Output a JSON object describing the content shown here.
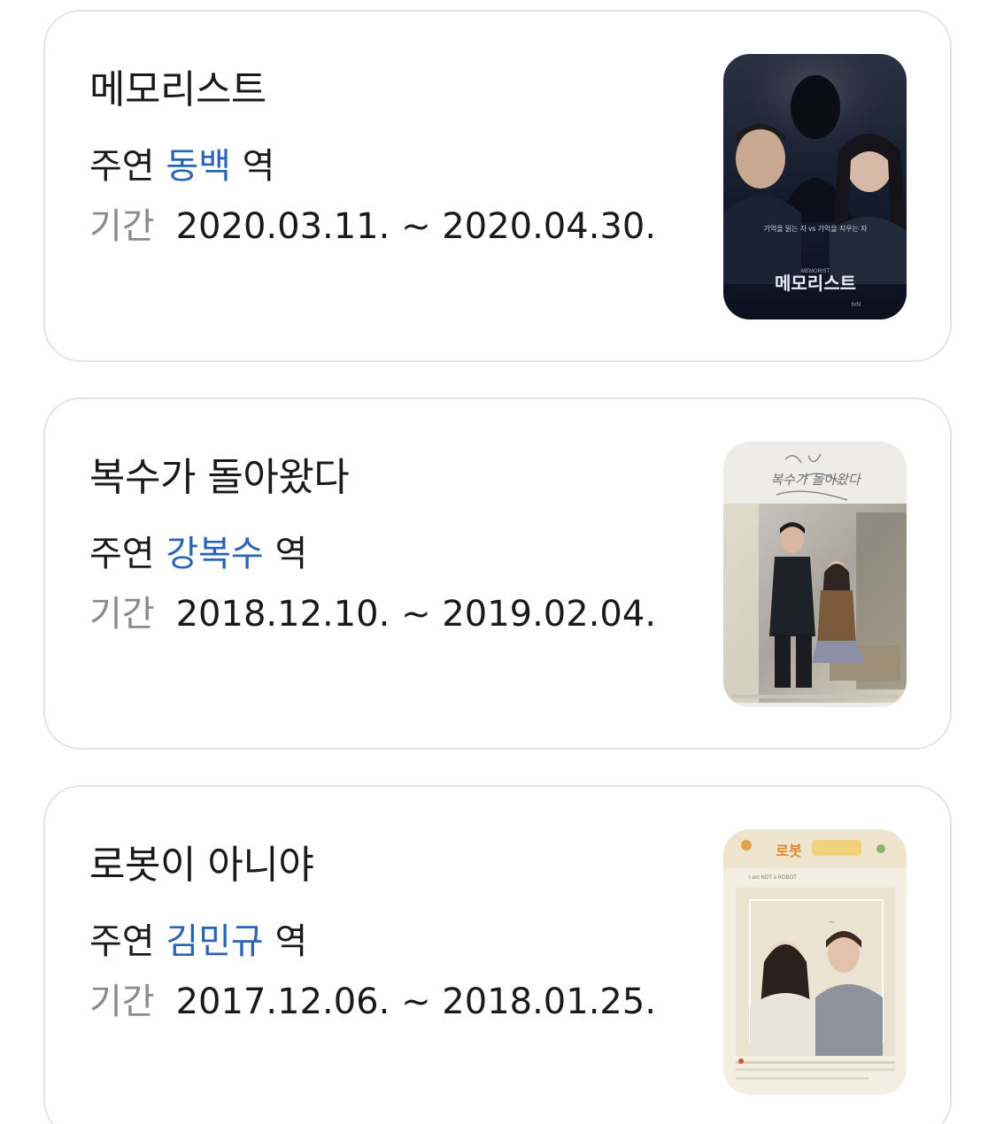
{
  "dramas": [
    {
      "title": "메모리스트",
      "role_prefix": "주연",
      "role_name": "동백",
      "role_suffix": "역",
      "period_label": "기간",
      "period": "2020.03.11. ~ 2020.04.30.",
      "poster": {
        "title_text": "메모리스트",
        "tagline": "기억을 읽는 자 vs 기억을 지우는 자",
        "subtitle": "MEMORIST",
        "network": "tvN"
      }
    },
    {
      "title": "복수가 돌아왔다",
      "role_prefix": "주연",
      "role_name": "강복수",
      "role_suffix": "역",
      "period_label": "기간",
      "period": "2018.12.10. ~ 2019.02.04.",
      "poster": {
        "title_text": "복수가 돌아왔다"
      }
    },
    {
      "title": "로봇이 아니야",
      "role_prefix": "주연",
      "role_name": "김민규",
      "role_suffix": "역",
      "period_label": "기간",
      "period": "2017.12.06. ~ 2018.01.25.",
      "poster": {
        "title_text": "로봇",
        "subtitle": "I am NOT a ROBOT"
      }
    }
  ]
}
